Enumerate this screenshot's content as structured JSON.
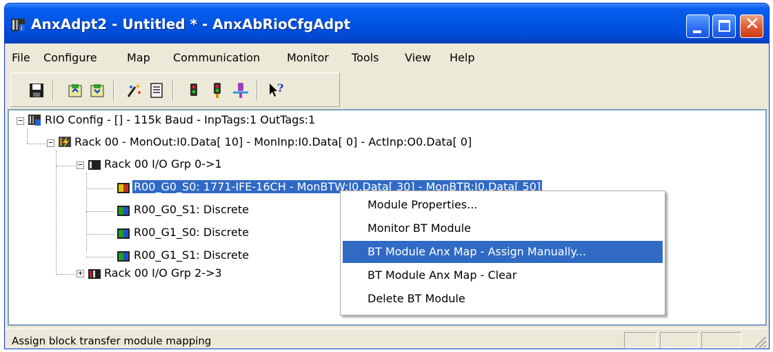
{
  "window": {
    "title": "AnxAdpt2 - Untitled * - AnxAbRioCfgAdpt",
    "icon": "app-rack-icon"
  },
  "menubar": {
    "items": [
      "File",
      "Configure",
      "Map",
      "Communication",
      "Monitor",
      "Tools",
      "View",
      "Help"
    ]
  },
  "toolbar": {
    "buttons": [
      "save-icon",
      "upload-icon",
      "download-icon",
      "wizard-icon",
      "document-icon",
      "connect-icon",
      "monitor-icon",
      "disconnect-icon",
      "context-help-icon"
    ]
  },
  "tree": {
    "root": {
      "label": "RIO Config - [] - 115k Baud - InpTags:1 OutTags:1",
      "expander": "−"
    },
    "rack": {
      "label": "Rack 00 - MonOut:I0.Data[ 10] - MonInp:I0.Data[  0] - ActInp:O0.Data[  0]",
      "expander": "−"
    },
    "group1": {
      "label": "Rack 00 I/O Grp 0->1",
      "expander": "−"
    },
    "modules": [
      {
        "label": "R00_G0_S0: 1771-IFE-16CH - MonBTW:I0.Data[ 30] - MonBTR:I0.Data[ 50]"
      },
      {
        "label": "R00_G0_S1: Discrete"
      },
      {
        "label": "R00_G1_S0: Discrete"
      },
      {
        "label": "R00_G1_S1: Discrete"
      }
    ],
    "group2": {
      "label": "Rack 00 I/O Grp 2->3",
      "expander": "+"
    }
  },
  "context_menu": {
    "items": [
      "Module Properties...",
      "Monitor BT Module",
      "BT Module Anx Map - Assign Manually...",
      "BT Module Anx Map - Clear",
      "Delete BT Module"
    ],
    "highlighted": 2
  },
  "statusbar": {
    "text": "Assign block transfer module mapping"
  },
  "colors": {
    "titlebar": "#0054e3",
    "selection": "#316ac5",
    "window_bg": "#ece9d8"
  }
}
